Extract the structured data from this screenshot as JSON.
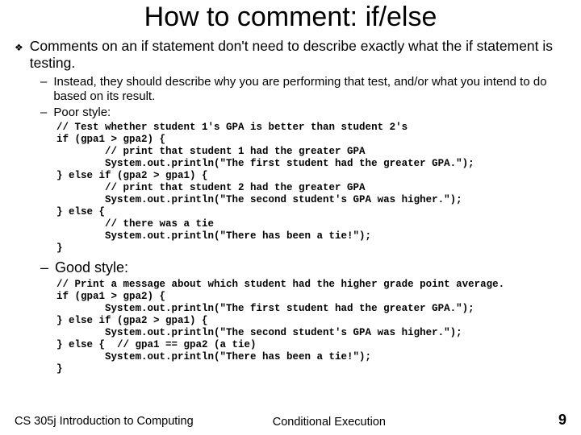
{
  "title": "How to comment: if/else",
  "bullet": "Comments on an if statement don't need to describe exactly what the if statement is testing.",
  "sub1": "Instead, they should describe why you are performing that test, and/or what you intend to do based on its result.",
  "sub2": "Poor style:",
  "code1": "// Test whether student 1's GPA is better than student 2's\nif (gpa1 > gpa2) {\n        // print that student 1 had the greater GPA\n        System.out.println(\"The first student had the greater GPA.\");\n} else if (gpa2 > gpa1) {\n        // print that student 2 had the greater GPA\n        System.out.println(\"The second student's GPA was higher.\");\n} else {\n        // there was a tie\n        System.out.println(\"There has been a tie!\");\n}",
  "sub3": "Good style:",
  "code2": "// Print a message about which student had the higher grade point average.\nif (gpa1 > gpa2) {\n        System.out.println(\"The first student had the greater GPA.\");\n} else if (gpa2 > gpa1) {\n        System.out.println(\"The second student's GPA was higher.\");\n} else {  // gpa1 == gpa2 (a tie)\n        System.out.println(\"There has been a tie!\");\n}",
  "footer": {
    "left": "CS 305j Introduction to Computing",
    "center": "Conditional Execution",
    "page": "9"
  }
}
